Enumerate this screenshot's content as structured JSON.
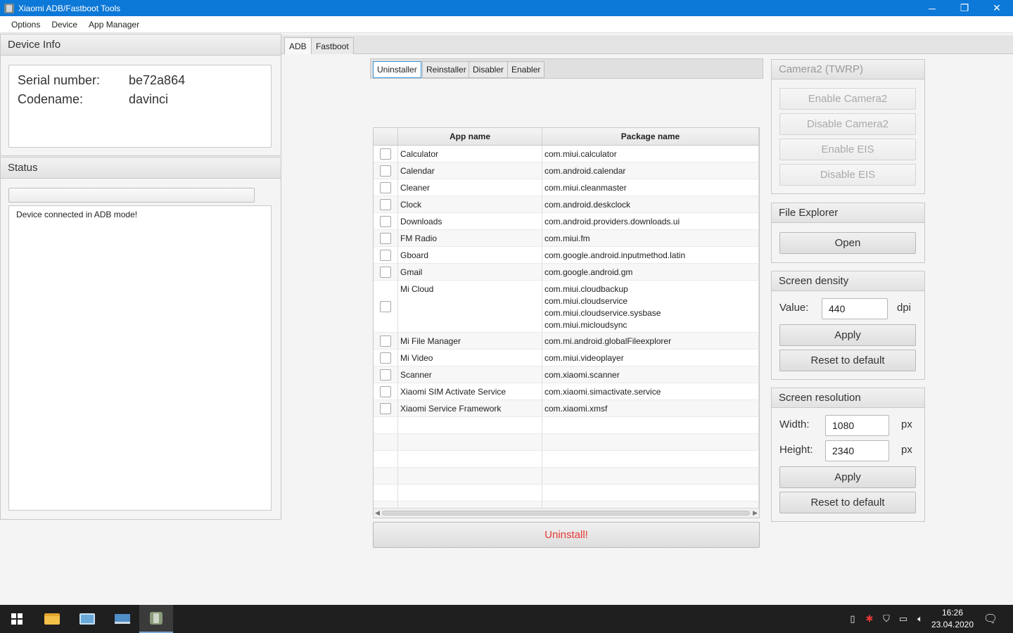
{
  "window": {
    "title": "Xiaomi ADB/Fastboot Tools",
    "minimize": "─",
    "maximize": "❐",
    "close": "✕"
  },
  "menu": [
    "Options",
    "Device",
    "App Manager"
  ],
  "device_info": {
    "header": "Device Info",
    "serial_label": "Serial number:",
    "serial_value": "be72a864",
    "codename_label": "Codename:",
    "codename_value": "davinci"
  },
  "status": {
    "header": "Status",
    "progress": 0,
    "log": "Device connected in ADB mode!"
  },
  "main_tabs": [
    "ADB",
    "Fastboot"
  ],
  "sub_tabs": [
    "Uninstaller",
    "Reinstaller",
    "Disabler",
    "Enabler"
  ],
  "table": {
    "col_app": "App name",
    "col_pkg": "Package name",
    "rows": [
      {
        "app": "Calculator",
        "pkgs": [
          "com.miui.calculator"
        ]
      },
      {
        "app": "Calendar",
        "pkgs": [
          "com.android.calendar"
        ]
      },
      {
        "app": "Cleaner",
        "pkgs": [
          "com.miui.cleanmaster"
        ]
      },
      {
        "app": "Clock",
        "pkgs": [
          "com.android.deskclock"
        ]
      },
      {
        "app": "Downloads",
        "pkgs": [
          "com.android.providers.downloads.ui"
        ]
      },
      {
        "app": "FM Radio",
        "pkgs": [
          "com.miui.fm"
        ]
      },
      {
        "app": "Gboard",
        "pkgs": [
          "com.google.android.inputmethod.latin"
        ]
      },
      {
        "app": "Gmail",
        "pkgs": [
          "com.google.android.gm"
        ]
      },
      {
        "app": "Mi Cloud",
        "pkgs": [
          "com.miui.cloudbackup",
          "com.miui.cloudservice",
          "com.miui.cloudservice.sysbase",
          "com.miui.micloudsync"
        ]
      },
      {
        "app": "Mi File Manager",
        "pkgs": [
          "com.mi.android.globalFileexplorer"
        ]
      },
      {
        "app": "Mi Video",
        "pkgs": [
          "com.miui.videoplayer"
        ]
      },
      {
        "app": "Scanner",
        "pkgs": [
          "com.xiaomi.scanner"
        ]
      },
      {
        "app": "Xiaomi SIM Activate Service",
        "pkgs": [
          "com.xiaomi.simactivate.service"
        ]
      },
      {
        "app": "Xiaomi Service Framework",
        "pkgs": [
          "com.xiaomi.xmsf"
        ]
      }
    ]
  },
  "uninstall_button": "Uninstall!",
  "camera2": {
    "header": "Camera2 (TWRP)",
    "enable_camera2": "Enable Camera2",
    "disable_camera2": "Disable Camera2",
    "enable_eis": "Enable EIS",
    "disable_eis": "Disable EIS"
  },
  "file_explorer": {
    "header": "File Explorer",
    "open": "Open"
  },
  "screen_density": {
    "header": "Screen density",
    "value_label": "Value:",
    "value": "440",
    "unit": "dpi",
    "apply": "Apply",
    "reset": "Reset to default"
  },
  "screen_resolution": {
    "header": "Screen resolution",
    "width_label": "Width:",
    "width": "1080",
    "height_label": "Height:",
    "height": "2340",
    "unit": "px",
    "apply": "Apply",
    "reset": "Reset to default"
  },
  "taskbar": {
    "time": "16:26",
    "date": "23.04.2020",
    "tray_icons": [
      "usb-icon",
      "antivirus-icon",
      "security-shield-icon",
      "network-icon",
      "volume-icon"
    ]
  },
  "colors": {
    "titlebar": "#0c78d7",
    "accent": "#3b95d6",
    "danger": "#e53935",
    "taskbar": "#1f1f1f"
  }
}
